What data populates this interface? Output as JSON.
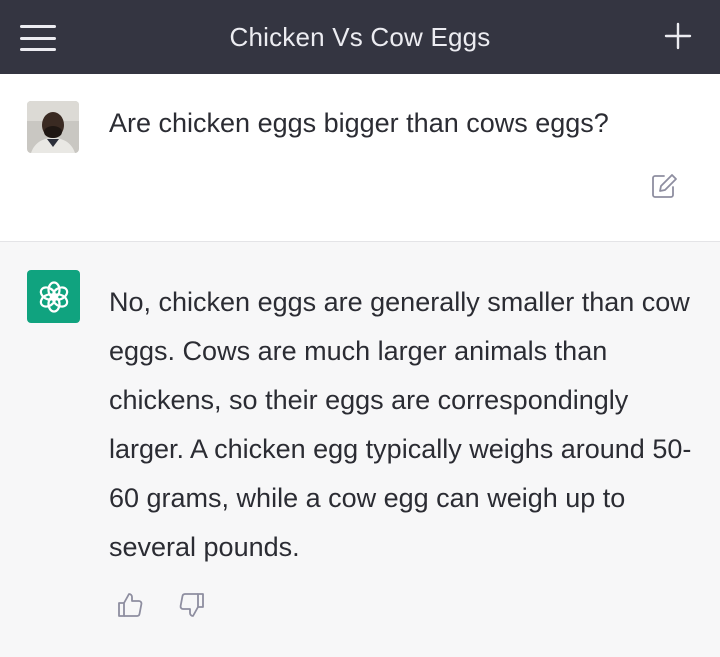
{
  "header": {
    "title": "Chicken Vs Cow Eggs",
    "menu_icon": "hamburger-menu-icon",
    "new_chat_icon": "plus-icon",
    "background": "#343541"
  },
  "conversation": {
    "user_message": {
      "text": "Are chicken eggs bigger than cows eggs?",
      "edit_icon": "edit-icon"
    },
    "assistant_message": {
      "text": "No, chicken eggs are generally smaller than cow eggs. Cows are much larger animals than chickens, so their eggs are correspondingly larger. A chicken egg typically weighs around 50-60 grams, while a cow egg can weigh up to several pounds.",
      "logo_color": "#10a37f",
      "feedback_icons": [
        "thumbs-up-icon",
        "thumbs-down-icon"
      ]
    }
  }
}
